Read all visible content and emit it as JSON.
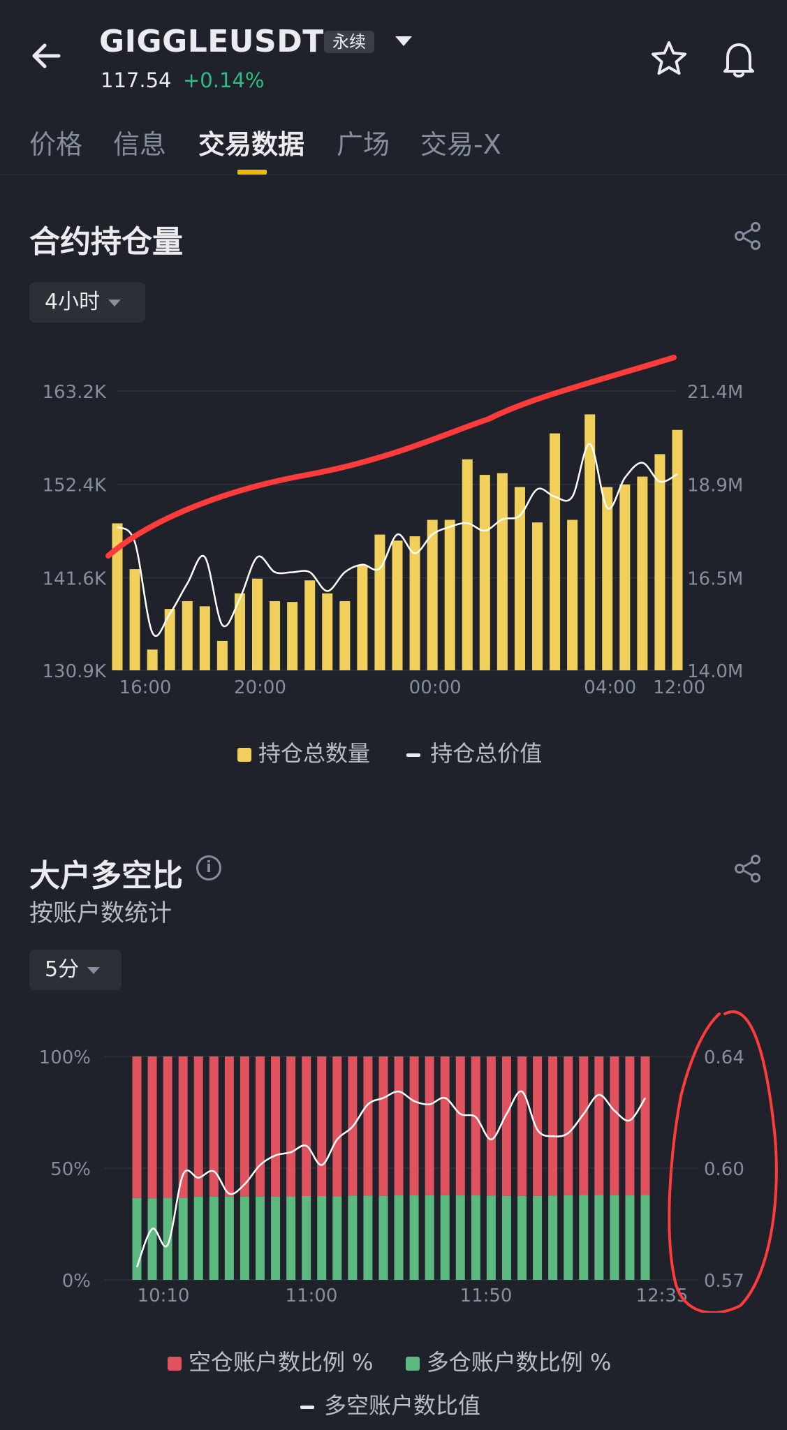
{
  "header": {
    "symbol": "GIGGLEUSDT",
    "badge": "永续",
    "price": "117.54",
    "change": "+0.14%"
  },
  "tabs": [
    {
      "label": "价格"
    },
    {
      "label": "信息"
    },
    {
      "label": "交易数据"
    },
    {
      "label": "广场"
    },
    {
      "label": "交易-X"
    }
  ],
  "oi_section": {
    "title": "合约持仓量",
    "interval": "4小时",
    "legend": [
      "持仓总数量",
      "持仓总价值"
    ]
  },
  "ls_section": {
    "title": "大户多空比",
    "subtitle": "按账户数统计",
    "interval": "5分",
    "legend": [
      "空仓账户数比例 %",
      "多仓账户数比例 %",
      "多空账户数比值"
    ]
  },
  "colors": {
    "bar": "#f0d05a",
    "line": "#ffffff",
    "short": "#e0525e",
    "long": "#5cb97f",
    "annotation": "#ff3b3b"
  },
  "chart_data": [
    {
      "type": "bar",
      "title": "合约持仓量",
      "x_ticks": [
        "16:00",
        "20:00",
        "00:00",
        "04:00",
        "12:00"
      ],
      "y_left_ticks": [
        "130.9K",
        "141.6K",
        "152.4K",
        "163.2K"
      ],
      "y_right_ticks": [
        "14.0M",
        "16.5M",
        "18.9M",
        "21.4M"
      ],
      "ylim_left": [
        130.9,
        163.2
      ],
      "ylim_right": [
        14.0,
        21.4
      ],
      "series": [
        {
          "name": "持仓总数量",
          "unit": "K",
          "values": [
            147.9,
            142.6,
            133.3,
            138.0,
            138.9,
            138.3,
            134.3,
            139.8,
            141.5,
            138.9,
            138.8,
            141.3,
            139.8,
            138.9,
            143.1,
            146.6,
            145.9,
            146.4,
            148.3,
            148.3,
            155.3,
            153.5,
            153.7,
            152.1,
            148.0,
            158.3,
            148.3,
            160.5,
            152.1,
            152.4,
            153.3,
            155.9,
            158.7
          ]
        },
        {
          "name": "持仓总价值",
          "unit": "M",
          "values": [
            17.8,
            17.4,
            15.0,
            15.5,
            16.3,
            17.0,
            15.2,
            15.9,
            17.0,
            16.6,
            16.6,
            16.6,
            16.1,
            16.6,
            16.8,
            16.7,
            17.6,
            17.1,
            17.6,
            17.8,
            17.9,
            17.7,
            18.0,
            18.1,
            18.8,
            18.6,
            18.6,
            20.0,
            18.3,
            19.1,
            19.5,
            19.0,
            19.2
          ]
        }
      ]
    },
    {
      "type": "bar",
      "title": "大户多空比",
      "x_ticks": [
        "10:10",
        "11:00",
        "11:50",
        "12:35"
      ],
      "y_left_ticks": [
        "0%",
        "50%",
        "100%"
      ],
      "y_right_ticks": [
        "0.57",
        "0.60",
        "0.64"
      ],
      "ylim_right": [
        0.57,
        0.64
      ],
      "series": [
        {
          "name": "空仓账户数比例 %",
          "values": [
            63.4,
            63.5,
            63.3,
            63.3,
            62.8,
            62.8,
            62.8,
            62.8,
            62.8,
            62.7,
            62.6,
            62.5,
            62.5,
            62.6,
            62.3,
            62.3,
            62.4,
            62.2,
            62.2,
            62.1,
            62.1,
            62.2,
            62.2,
            62.3,
            62.4,
            62.4,
            62.4,
            62.3,
            62.1,
            62.0,
            62.0,
            62.1,
            62.2,
            62.0
          ]
        },
        {
          "name": "多仓账户数比例 %",
          "values": [
            36.6,
            36.5,
            36.7,
            36.7,
            37.2,
            37.2,
            37.2,
            37.2,
            37.2,
            37.3,
            37.4,
            37.5,
            37.5,
            37.4,
            37.7,
            37.7,
            37.6,
            37.8,
            37.8,
            37.9,
            37.9,
            37.8,
            37.8,
            37.7,
            37.6,
            37.6,
            37.6,
            37.7,
            37.9,
            38.0,
            38.0,
            37.9,
            37.8,
            38.0
          ]
        },
        {
          "name": "多空账户数比值",
          "values": [
            0.574,
            0.586,
            0.581,
            0.603,
            0.602,
            0.604,
            0.597,
            0.6,
            0.606,
            0.609,
            0.61,
            0.612,
            0.606,
            0.614,
            0.618,
            0.625,
            0.627,
            0.629,
            0.626,
            0.625,
            0.627,
            0.622,
            0.621,
            0.614,
            0.622,
            0.629,
            0.617,
            0.615,
            0.616,
            0.622,
            0.628,
            0.623,
            0.62,
            0.627
          ]
        }
      ]
    }
  ]
}
